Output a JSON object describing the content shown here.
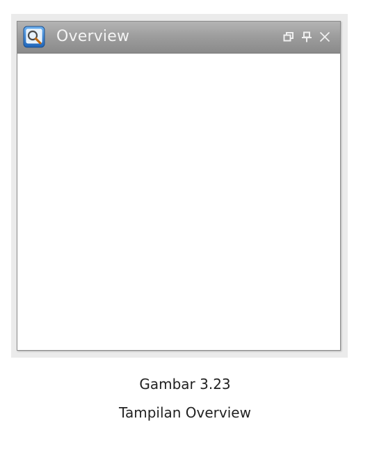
{
  "window": {
    "title": "Overview",
    "title_icon": "magnifier-icon",
    "controls": [
      {
        "name": "float-window-icon"
      },
      {
        "name": "pin-icon"
      },
      {
        "name": "close-icon"
      }
    ]
  },
  "caption": {
    "number": "Gambar 3.23",
    "title": "Tampilan Overview"
  },
  "colors": {
    "titlebar_top": "#b4b4b4",
    "titlebar_bottom": "#8a8a8a",
    "title_text": "#f4f4f4",
    "icon_blue": "#2f7fd0",
    "content_bg": "#ffffff",
    "frame_bg": "#ebebeb"
  }
}
